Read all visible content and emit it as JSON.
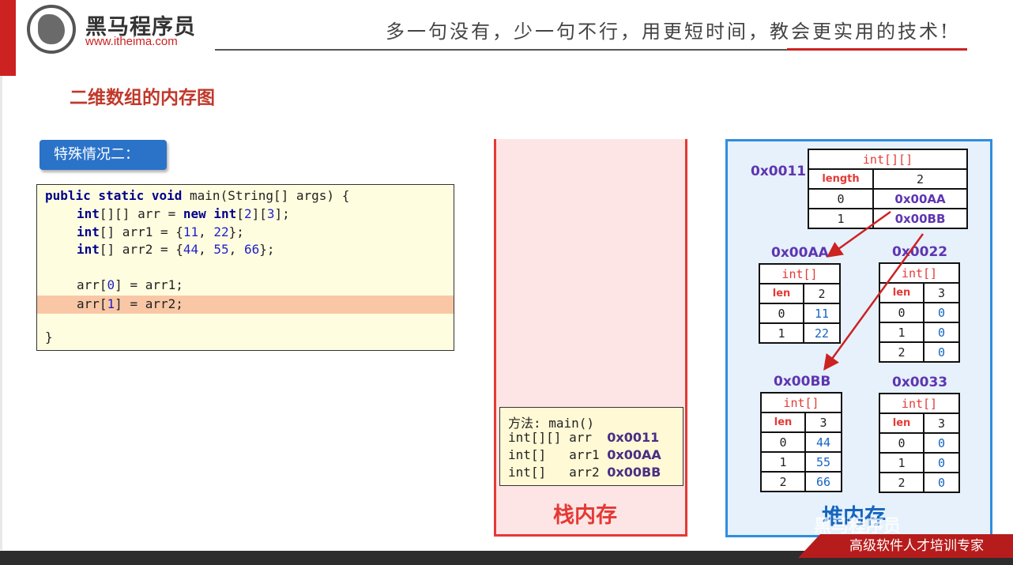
{
  "header": {
    "brand": "黑马程序员",
    "url": "www.itheima.com",
    "slogan": "多一句没有，少一句不行，用更短时间，教会更实用的技术!"
  },
  "section_title": "二维数组的内存图",
  "case_badge": "特殊情况二：",
  "code": {
    "line1": [
      "public static void ",
      "main(String[] args) {"
    ],
    "line2": [
      "int",
      "[][] arr = ",
      "new ",
      "int",
      "[",
      "2",
      "][",
      "3",
      "];"
    ],
    "line3": [
      "int",
      "[] arr1 = {",
      "11",
      ", ",
      "22",
      "};"
    ],
    "line4": [
      "int",
      "[] arr2 = {",
      "44",
      ", ",
      "55",
      ", ",
      "66",
      "};"
    ],
    "line5": [
      "arr[",
      "0",
      "] = arr1;"
    ],
    "line6": [
      "arr[",
      "1",
      "] = arr2;"
    ],
    "line7": "}"
  },
  "stack": {
    "frame_title": "方法: main()",
    "vars": [
      {
        "decl": "int[][] arr  ",
        "addr": "0x0011"
      },
      {
        "decl": "int[]   arr1 ",
        "addr": "0x00AA"
      },
      {
        "decl": "int[]   arr2 ",
        "addr": "0x00BB"
      }
    ],
    "label": "栈内存"
  },
  "heap": {
    "label": "堆内存",
    "outer": {
      "addr": "0x0011",
      "type": "int[][]",
      "len_label": "length",
      "len": "2",
      "rows": [
        [
          "0",
          "0x00AA"
        ],
        [
          "1",
          "0x00BB"
        ]
      ]
    },
    "arrays": [
      {
        "addr": "0x00AA",
        "type": "int[]",
        "len_label": "len",
        "len": "2",
        "rows": [
          [
            "0",
            "11"
          ],
          [
            "1",
            "22"
          ]
        ]
      },
      {
        "addr": "0x0022",
        "type": "int[]",
        "len_label": "len",
        "len": "3",
        "rows": [
          [
            "0",
            "0"
          ],
          [
            "1",
            "0"
          ],
          [
            "2",
            "0"
          ]
        ]
      },
      {
        "addr": "0x00BB",
        "type": "int[]",
        "len_label": "len",
        "len": "3",
        "rows": [
          [
            "0",
            "44"
          ],
          [
            "1",
            "55"
          ],
          [
            "2",
            "66"
          ]
        ]
      },
      {
        "addr": "0x0033",
        "type": "int[]",
        "len_label": "len",
        "len": "3",
        "rows": [
          [
            "0",
            "0"
          ],
          [
            "1",
            "0"
          ],
          [
            "2",
            "0"
          ]
        ]
      }
    ]
  },
  "footer": {
    "watermark": "黑马程序员",
    "tagline": "高级软件人才培训专家"
  },
  "colors": {
    "accent_red": "#cc2222",
    "badge_blue": "#2a73c9",
    "heap_border": "#2f8de0",
    "stack_border": "#e53935",
    "address_purple": "#5e35b1"
  }
}
